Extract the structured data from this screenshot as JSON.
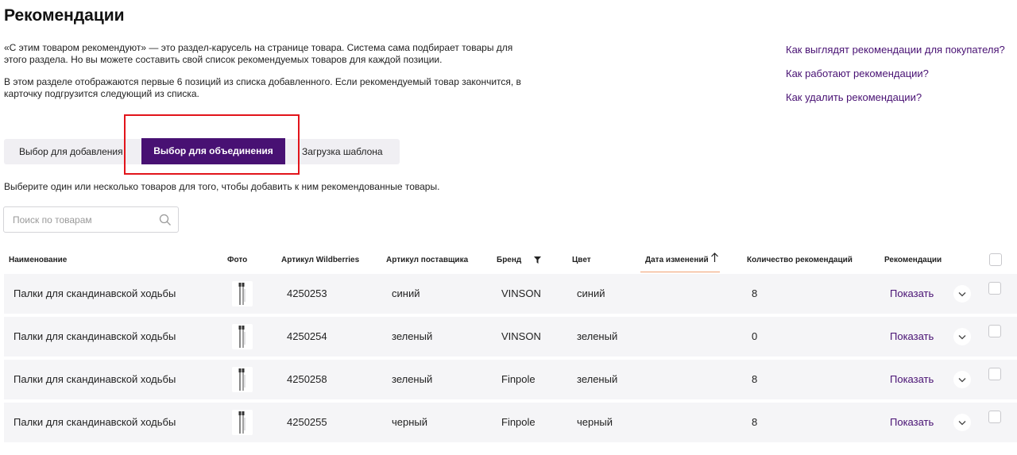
{
  "page": {
    "title": "Рекомендации",
    "description_1": "«С этим товаром рекомендуют» — это раздел-карусель на странице товара. Система сама подбирает товары для этого раздела. Но вы можете составить свой список рекомендуемых товаров для каждой позиции.",
    "description_2": "В этом разделе отображаются первые 6 позиций из списка добавленного. Если рекомендуемый товар закончится, в карточку подгрузится следующий из списка."
  },
  "help_links": [
    "Как выглядят рекомендации для покупателя?",
    "Как работают рекомендации?",
    "Как удалить рекомендации?"
  ],
  "tabs": {
    "add": "Выбор для добавления",
    "merge": "Выбор для объединения",
    "template": "Загрузка шаблона",
    "active": "merge"
  },
  "hint": "Выберите один или несколько товаров для того, чтобы добавить к ним рекомендованные товары.",
  "search": {
    "placeholder": "Поиск по товарам",
    "value": ""
  },
  "table": {
    "headers": {
      "name": "Наименование",
      "photo": "Фото",
      "wb_article": "Артикул Wildberries",
      "supplier_article": "Артикул поставщика",
      "brand": "Бренд",
      "color": "Цвет",
      "date_changed": "Дата изменений",
      "rec_count": "Количество рекомендаций",
      "recommendations": "Рекомендации"
    },
    "sort": {
      "column": "date_changed",
      "direction": "asc"
    },
    "rows": [
      {
        "name": "Палки для скандинавской ходьбы",
        "wb_article": "4250253",
        "supplier_article": "синий",
        "brand": "VINSON",
        "color": "синий",
        "rec_count": "8",
        "action": "Показать"
      },
      {
        "name": "Палки для скандинавской ходьбы",
        "wb_article": "4250254",
        "supplier_article": "зеленый",
        "brand": "VINSON",
        "color": "зеленый",
        "rec_count": "0",
        "action": "Показать"
      },
      {
        "name": "Палки для скандинавской ходьбы",
        "wb_article": "4250258",
        "supplier_article": "зеленый",
        "brand": "Finpole",
        "color": "зеленый",
        "rec_count": "8",
        "action": "Показать"
      },
      {
        "name": "Палки для скандинавской ходьбы",
        "wb_article": "4250255",
        "supplier_article": "черный",
        "brand": "Finpole",
        "color": "черный",
        "rec_count": "8",
        "action": "Показать"
      }
    ]
  },
  "colors": {
    "accent": "#481173",
    "highlight": "#e2141b",
    "row_bg": "#f5f5f7",
    "sort_underline": "#f0a070"
  },
  "icons": [
    "search-icon",
    "filter-icon",
    "sort-arrow-up-icon",
    "chevron-down-icon",
    "product-photo"
  ]
}
